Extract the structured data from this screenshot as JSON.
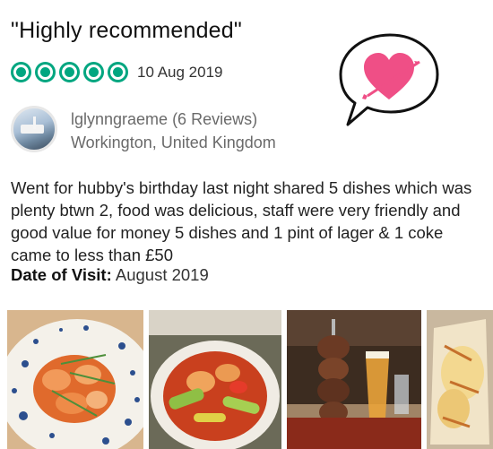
{
  "review": {
    "title": "\"Highly recommended\"",
    "rating": 5,
    "rating_max": 5,
    "date": "10 Aug 2019",
    "reviewer": {
      "name": "lglynngraeme (6 Reviews)",
      "location": "Workington, United Kingdom"
    },
    "body": "Went for hubby's birthday last night shared 5 dishes which was plenty btwn 2,  food was delicious, staff were very friendly and good value for money 5 dishes and 1 pint of lager & 1 coke came to less than £50",
    "visit_label": "Date of Visit:",
    "visit_value": "August 2019"
  },
  "icons": {
    "rating_bubble": "rating-bubble-icon",
    "badge": "heart-arrow-speech-bubble-icon"
  },
  "colors": {
    "rating_green": "#00a680",
    "heart_pink": "#ef4f86"
  }
}
